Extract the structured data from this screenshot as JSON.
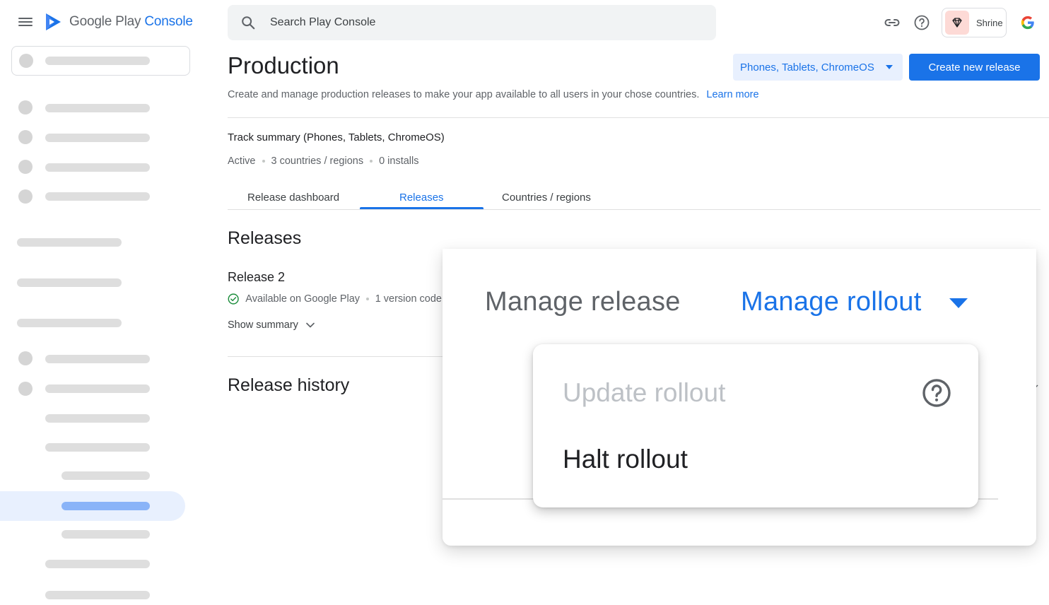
{
  "brand": {
    "google": "Google Play",
    "console": "Console"
  },
  "search": {
    "placeholder": "Search Play Console"
  },
  "topbar": {
    "app_name": "Shrine",
    "icons": [
      "link-icon",
      "help-icon",
      "shrine-logo-icon",
      "google-account-icon"
    ]
  },
  "page": {
    "title": "Production",
    "device_filter": "Phones, Tablets, ChromeOS",
    "create_button": "Create new release",
    "description": "Create and manage production releases to make your app available to all users in your chose countries.",
    "learn_more": "Learn more"
  },
  "track": {
    "title": "Track summary (Phones, Tablets, ChromeOS)",
    "status": "Active",
    "countries": "3 countries / regions",
    "installs": "0 installs"
  },
  "tabs": [
    {
      "label": "Release dashboard",
      "active": false
    },
    {
      "label": "Releases",
      "active": true
    },
    {
      "label": "Countries / regions",
      "active": false
    }
  ],
  "releases": {
    "section_title": "Releases",
    "release_name": "Release 2",
    "availability": "Available on Google Play",
    "version_codes": "1 version code",
    "show_summary": "Show summary",
    "history_title": "Release history"
  },
  "zoom": {
    "manage_release": "Manage release",
    "manage_rollout": "Manage rollout",
    "menu_items": [
      {
        "label": "Update rollout",
        "enabled": false
      },
      {
        "label": "Halt rollout",
        "enabled": true
      }
    ]
  },
  "colors": {
    "accent": "#1a73e8",
    "success": "#1e8e3e",
    "shrine_bg": "#fddad6"
  }
}
